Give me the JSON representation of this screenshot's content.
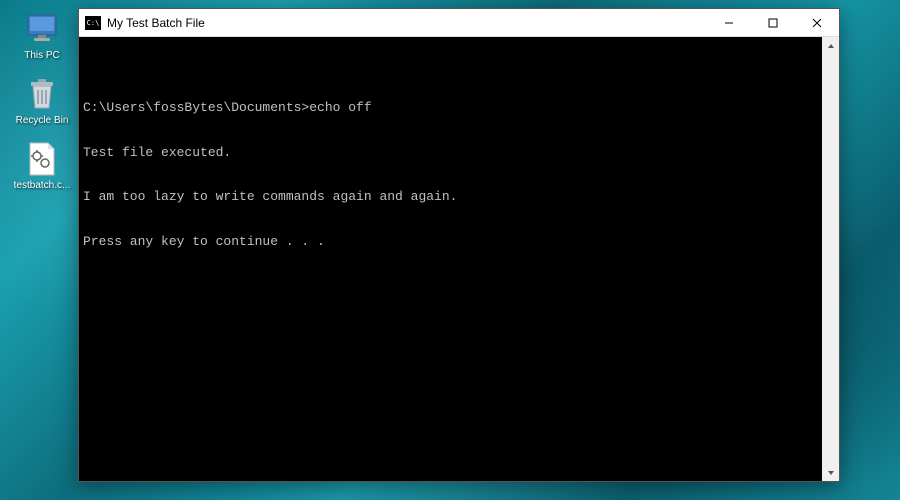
{
  "desktop": {
    "icons": [
      {
        "label": "This PC",
        "iconName": "this-pc-icon"
      },
      {
        "label": "Recycle Bin",
        "iconName": "recycle-bin-icon"
      },
      {
        "label": "testbatch.c...",
        "iconName": "batch-file-icon"
      }
    ]
  },
  "window": {
    "title": "My Test Batch File",
    "iconLabel": "C:\\",
    "controls": {
      "minimize": "min",
      "maximize": "max",
      "close": "close"
    }
  },
  "console": {
    "lines": [
      "",
      "C:\\Users\\fossBytes\\Documents>echo off",
      "Test file executed.",
      "I am too lazy to write commands again and again.",
      "Press any key to continue . . ."
    ]
  }
}
